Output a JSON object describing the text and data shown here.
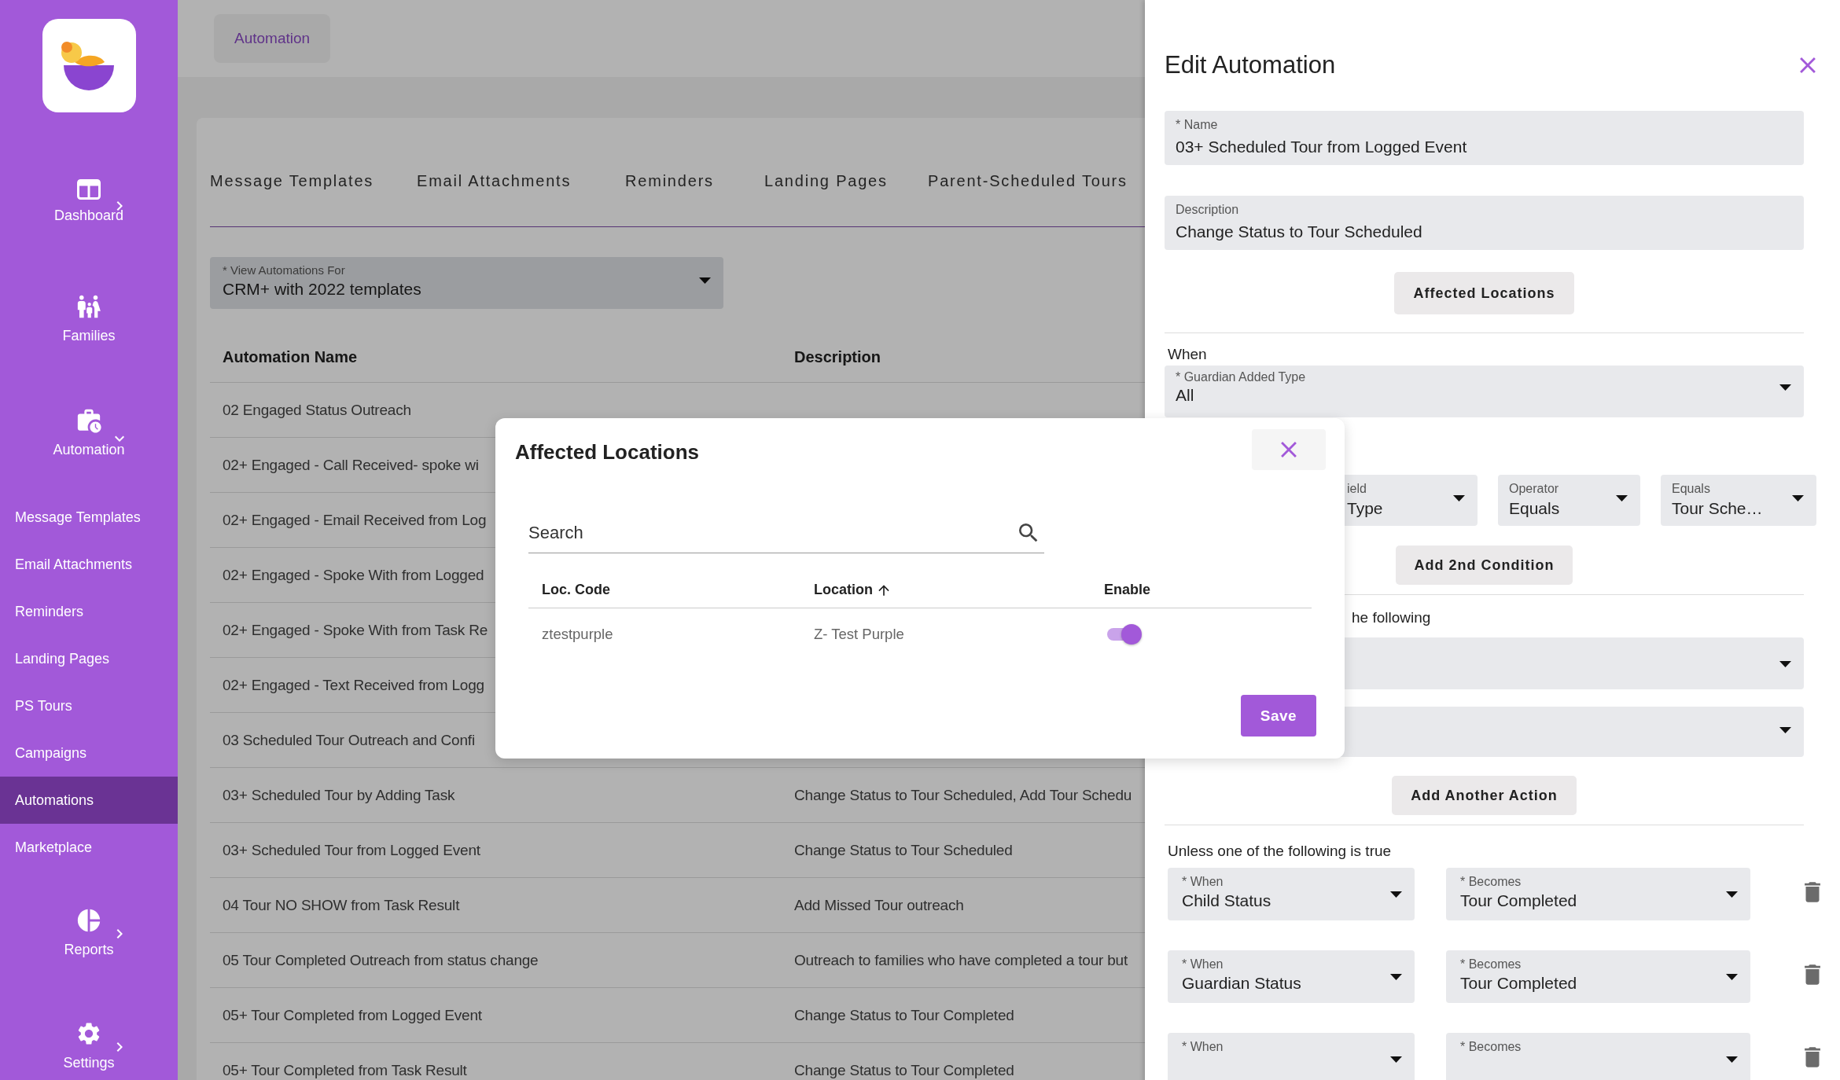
{
  "sidebar": {
    "nav_top": [
      {
        "label": "Dashboard",
        "kind": "group",
        "expanded": false
      },
      {
        "label": "Families",
        "kind": "link"
      },
      {
        "label": "Automation",
        "kind": "group",
        "expanded": true
      }
    ],
    "submenu": [
      {
        "label": "Message Templates",
        "selected": false
      },
      {
        "label": "Email Attachments",
        "selected": false
      },
      {
        "label": "Reminders",
        "selected": false
      },
      {
        "label": "Landing Pages",
        "selected": false
      },
      {
        "label": "PS Tours",
        "selected": false
      },
      {
        "label": "Campaigns",
        "selected": false
      },
      {
        "label": "Automations",
        "selected": true
      },
      {
        "label": "Marketplace",
        "selected": false
      }
    ],
    "nav_bottom": [
      {
        "label": "Reports",
        "kind": "group",
        "expanded": false
      },
      {
        "label": "Settings",
        "kind": "group",
        "expanded": false
      }
    ]
  },
  "breadcrumb": "Automation",
  "tabs": [
    {
      "label": "Message Templates",
      "selected": false
    },
    {
      "label": "Email Attachments",
      "selected": false
    },
    {
      "label": "Reminders",
      "selected": false
    },
    {
      "label": "Landing Pages",
      "selected": false
    },
    {
      "label": "Parent-Scheduled Tours",
      "selected": false
    }
  ],
  "view_select": {
    "label": "* View Automations For",
    "value": "CRM+ with 2022 templates"
  },
  "table": {
    "columns": [
      "Automation Name",
      "Description"
    ],
    "rows": [
      {
        "name": "02 Engaged Status Outreach"
      },
      {
        "name": "02+ Engaged - Call Received- spoke wi"
      },
      {
        "name": "02+ Engaged - Email Received from Log"
      },
      {
        "name": "02+ Engaged - Spoke With from Logged"
      },
      {
        "name": "02+ Engaged - Spoke With from Task Re"
      },
      {
        "name": "02+ Engaged - Text Received from Logg"
      },
      {
        "name": "03 Scheduled Tour Outreach and Confi"
      },
      {
        "name": "03+ Scheduled Tour by Adding Task",
        "description": "Change Status to Tour Scheduled, Add Tour Schedu"
      },
      {
        "name": "03+ Scheduled Tour from Logged Event",
        "description": "Change Status to Tour Scheduled"
      },
      {
        "name": "04 Tour NO SHOW from Task Result",
        "description": "Add Missed Tour outreach"
      },
      {
        "name": "05 Tour Completed Outreach from status change",
        "description": "Outreach to families who have completed a tour but"
      },
      {
        "name": "05+ Tour Completed from Logged Event",
        "description": "Change Status to Tour Completed"
      },
      {
        "name": "05+ Tour Completed from Task Result",
        "description": "Change Status to Tour Completed"
      }
    ]
  },
  "drawer": {
    "title": "Edit Automation",
    "name_field": {
      "label": "* Name",
      "value": "03+ Scheduled Tour from Logged Event"
    },
    "description_field": {
      "label": "Description",
      "value": "Change Status to Tour Scheduled"
    },
    "affected_button": "Affected Locations",
    "when_label": "When",
    "guardian_select": {
      "label": "* Guardian Added Type",
      "value": "All"
    },
    "condition": [
      {
        "label": "ield",
        "value": "Type"
      },
      {
        "label": "Operator",
        "value": "Equals"
      },
      {
        "label": "Equals",
        "value": "Tour Sche…"
      }
    ],
    "add_condition_button": "Add 2nd Condition",
    "then_label": "he following",
    "add_action_button": "Add Another Action",
    "unless_label": "Unless one of the following is true",
    "unless_rows": [
      {
        "when_label": "* When",
        "when_value": "Child Status",
        "becomes_label": "* Becomes",
        "becomes_value": "Tour Completed"
      },
      {
        "when_label": "* When",
        "when_value": "Guardian Status",
        "becomes_label": "* Becomes",
        "becomes_value": "Tour Completed"
      },
      {
        "when_label": "* When",
        "becomes_label": "* Becomes"
      }
    ]
  },
  "modal": {
    "title": "Affected Locations",
    "search_placeholder": "Search",
    "columns": [
      {
        "label": "Loc. Code",
        "sorted": false
      },
      {
        "label": "Location",
        "sorted": true
      },
      {
        "label": "Enable",
        "sorted": false
      }
    ],
    "rows": [
      {
        "code": "ztestpurple",
        "location": "Z- Test Purple",
        "enabled": true
      }
    ],
    "save_button": "Save"
  }
}
